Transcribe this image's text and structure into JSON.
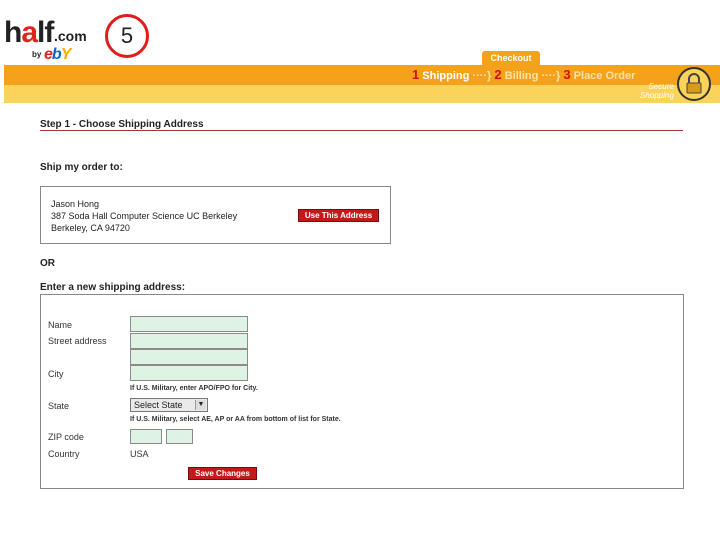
{
  "logo": {
    "half": "h",
    "half_a": "a",
    "half_rest": "lf",
    "com": ".com",
    "by": "by",
    "ebay": "ebY"
  },
  "badge": "5",
  "header": {
    "tab": "Checkout",
    "steps": [
      {
        "num": "1",
        "label": "Shipping"
      },
      {
        "num": "2",
        "label": "Billing"
      },
      {
        "num": "3",
        "label": "Place Order"
      }
    ],
    "arrow": "····}",
    "secure_line1": "Secure",
    "secure_line2": "Shopping",
    "colors": {
      "orange": "#f4a21c",
      "yellow": "#fbd35a",
      "red": "#c21a1a"
    }
  },
  "page": {
    "step_title": "Step 1 - Choose Shipping Address",
    "ship_to": "Ship my order to:",
    "address": [
      "Jason Hong",
      "387 Soda Hall Computer Science UC Berkeley",
      "Berkeley, CA 94720"
    ],
    "use_button": "Use This Address",
    "or": "OR",
    "new_address": "Enter a new shipping address:"
  },
  "form": {
    "name_label": "Name",
    "street_label": "Street address",
    "city_label": "City",
    "city_note": "If U.S. Military, enter APO/FPO for City.",
    "state_label": "State",
    "state_value": "Select State",
    "state_note": "If U.S. Military, select AE, AP or AA from bottom of list for State.",
    "zip_label": "ZIP code",
    "country_label": "Country",
    "country_value": "USA",
    "save_button": "Save Changes"
  }
}
